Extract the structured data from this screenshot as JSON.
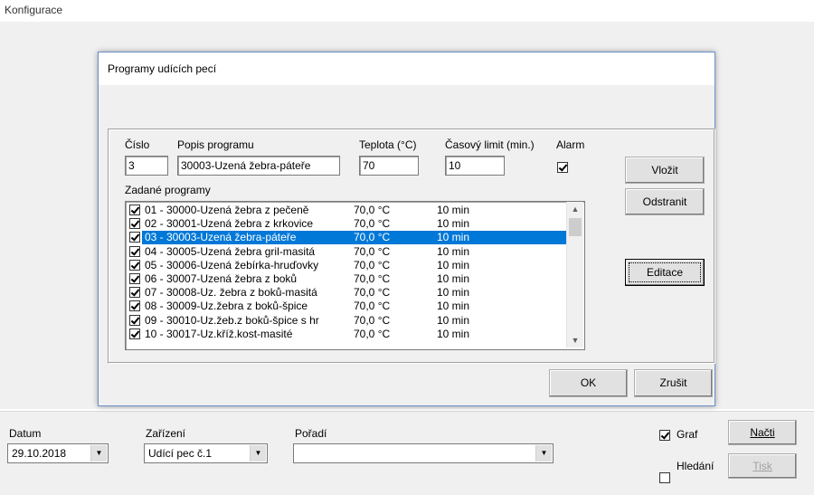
{
  "window": {
    "title": "Konfigurace"
  },
  "dialog": {
    "title": "Programy udících pecí",
    "close_glyph": "✕",
    "fields": {
      "cislo_label": "Číslo",
      "cislo_value": "3",
      "popis_label": "Popis programu",
      "popis_value": "30003-Uzená žebra-páteře",
      "teplota_label": "Teplota (°C)",
      "teplota_value": "70",
      "limit_label": "Časový limit (min.)",
      "limit_value": "10",
      "alarm_label": "Alarm",
      "alarm_checked": true
    },
    "list_label": "Zadané programy",
    "programs": [
      {
        "name": "01 - 30000-Uzená žebra z pečeně",
        "temp": "70,0 °C",
        "time": "10 min",
        "checked": true,
        "selected": false
      },
      {
        "name": "02 - 30001-Uzená žebra z krkovice",
        "temp": "70,0 °C",
        "time": "10 min",
        "checked": true,
        "selected": false
      },
      {
        "name": "03 - 30003-Uzená žebra-páteře",
        "temp": "70,0 °C",
        "time": "10 min",
        "checked": true,
        "selected": true
      },
      {
        "name": "04 - 30005-Uzená žebra gril-masitá",
        "temp": "70,0 °C",
        "time": "10 min",
        "checked": true,
        "selected": false
      },
      {
        "name": "05 - 30006-Uzená žebírka-hruďovky",
        "temp": "70,0 °C",
        "time": "10 min",
        "checked": true,
        "selected": false
      },
      {
        "name": "06 - 30007-Uzená žebra z boků",
        "temp": "70,0 °C",
        "time": "10 min",
        "checked": true,
        "selected": false
      },
      {
        "name": "07 - 30008-Uz. žebra z boků-masitá",
        "temp": "70,0 °C",
        "time": "10 min",
        "checked": true,
        "selected": false
      },
      {
        "name": "08 - 30009-Uz.žebra z boků-špice",
        "temp": "70,0 °C",
        "time": "10 min",
        "checked": true,
        "selected": false
      },
      {
        "name": "09 - 30010-Uz.žeb.z boků-špice s hr",
        "temp": "70,0 °C",
        "time": "10 min",
        "checked": true,
        "selected": false
      },
      {
        "name": "10 - 30017-Uz.kříž.kost-masité",
        "temp": "70,0 °C",
        "time": "10 min",
        "checked": true,
        "selected": false
      }
    ],
    "buttons": {
      "vlozit": "Vložit",
      "odstranit": "Odstranit",
      "editace": "Editace",
      "ok": "OK",
      "zrusit": "Zrušit"
    }
  },
  "bottom": {
    "datum_label": "Datum",
    "datum_value": "29.10.2018",
    "zarizeni_label": "Zařízení",
    "zarizeni_value": "Udící pec č.1",
    "poradi_label": "Pořadí",
    "poradi_value": "",
    "graf_label": "Graf",
    "graf_checked": true,
    "hledani_label": "Hledání",
    "hledani_checked": false,
    "nacti_label": "Načti",
    "tisk_label": "Tisk"
  },
  "icons": {
    "dropdown": "chevron-down-icon",
    "close": "close-icon",
    "scroll_up": "scroll-up-icon",
    "scroll_down": "scroll-down-icon"
  }
}
